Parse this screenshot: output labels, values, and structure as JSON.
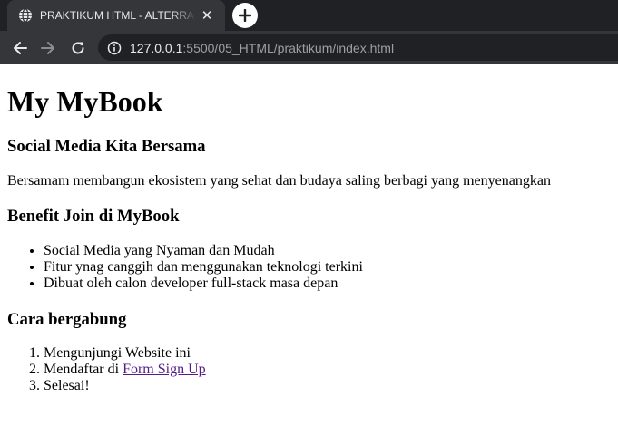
{
  "browser": {
    "tab_title": "PRAKTIKUM HTML - ALTERRA - ALTA",
    "url_host": "127.0.0.1",
    "url_rest": ":5500/05_HTML/praktikum/index.html",
    "icons": {
      "favicon": "globe-icon",
      "close": "close-icon",
      "new_tab": "plus-icon",
      "back": "arrow-left-icon",
      "forward": "arrow-right-icon",
      "reload": "reload-icon",
      "site_info": "info-icon"
    },
    "colors": {
      "tabstrip": "#202124",
      "toolbar": "#35363a",
      "link_visited": "#551a8b"
    }
  },
  "page": {
    "title": "My MyBook",
    "section_social": {
      "heading": "Social Media Kita Bersama",
      "text": "Bersamam membangun ekosistem yang sehat dan budaya saling berbagi yang menyenangkan"
    },
    "section_benefit": {
      "heading": "Benefit Join di MyBook",
      "items": [
        "Social Media yang Nyaman dan Mudah",
        "Fitur ynag canggih dan menggunakan teknologi terkini",
        "Dibuat oleh calon developer full-stack masa depan"
      ]
    },
    "section_join": {
      "heading": "Cara bergabung",
      "step1": "Mengunjungi Website ini",
      "step2_prefix": "Mendaftar di ",
      "step2_link": "Form Sign Up",
      "step3": "Selesai!"
    }
  }
}
